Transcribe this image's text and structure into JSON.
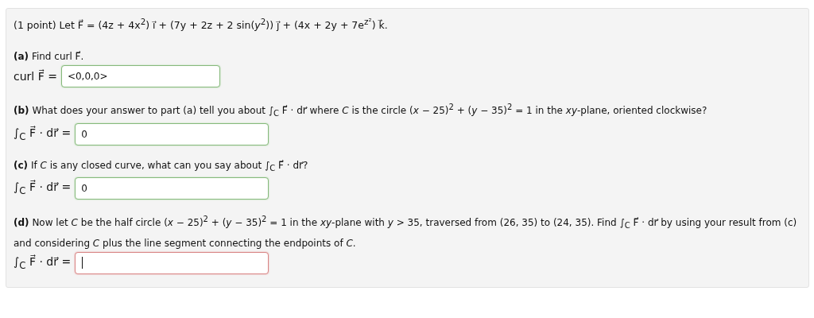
{
  "intro": "(1 point) Let F⃗ = (4z + 4x$^{2}$) i⃗ + (7y + 2z + 2 sin(*y*$^{2}$)) j⃗ + (4x + 2y + 7e$^{z²}$) k⃗.",
  "parts": [
    {
      "prompt": "**(a)** Find curl F⃗.",
      "answer_label": "curl F⃗ =",
      "answer": {
        "value": "<0,0,0>",
        "correct": true,
        "focused": false
      }
    },
    {
      "prompt": "**(b)** What does your answer to part (a) tell you about ∫$_{C}$ F⃗ · dr⃗ where *C* is the circle (*x* − 25)$^{2}$ + (*y* − 35)$^{2}$ = 1 in the *xy*-plane, oriented clockwise?",
      "answer_label": "∫$_{C}$ F⃗ · dr⃗ =",
      "answer": {
        "value": "0",
        "correct": true,
        "focused": false
      }
    },
    {
      "prompt": "**(c)** If *C* is any closed curve, what can you say about ∫$_{C}$ F⃗ · dr⃗?",
      "answer_label": "∫$_{C}$ F⃗ · dr⃗ =",
      "answer": {
        "value": "0",
        "correct": true,
        "focused": false
      }
    },
    {
      "prompt": "**(d)** Now let *C* be the half circle (*x* − 25)$^{2}$ + (*y* − 35)$^{2}$ = 1 in the *xy*-plane with *y* > 35, traversed from (26, 35) to (24, 35). Find ∫$_{C}$ F⃗ · dr⃗ by using your result from (c) and considering *C* plus the line segment connecting the endpoints of *C*.",
      "answer_label": "∫$_{C}$ F⃗ · dr⃗ =",
      "answer": {
        "correct": false,
        "focused": true
      }
    }
  ]
}
